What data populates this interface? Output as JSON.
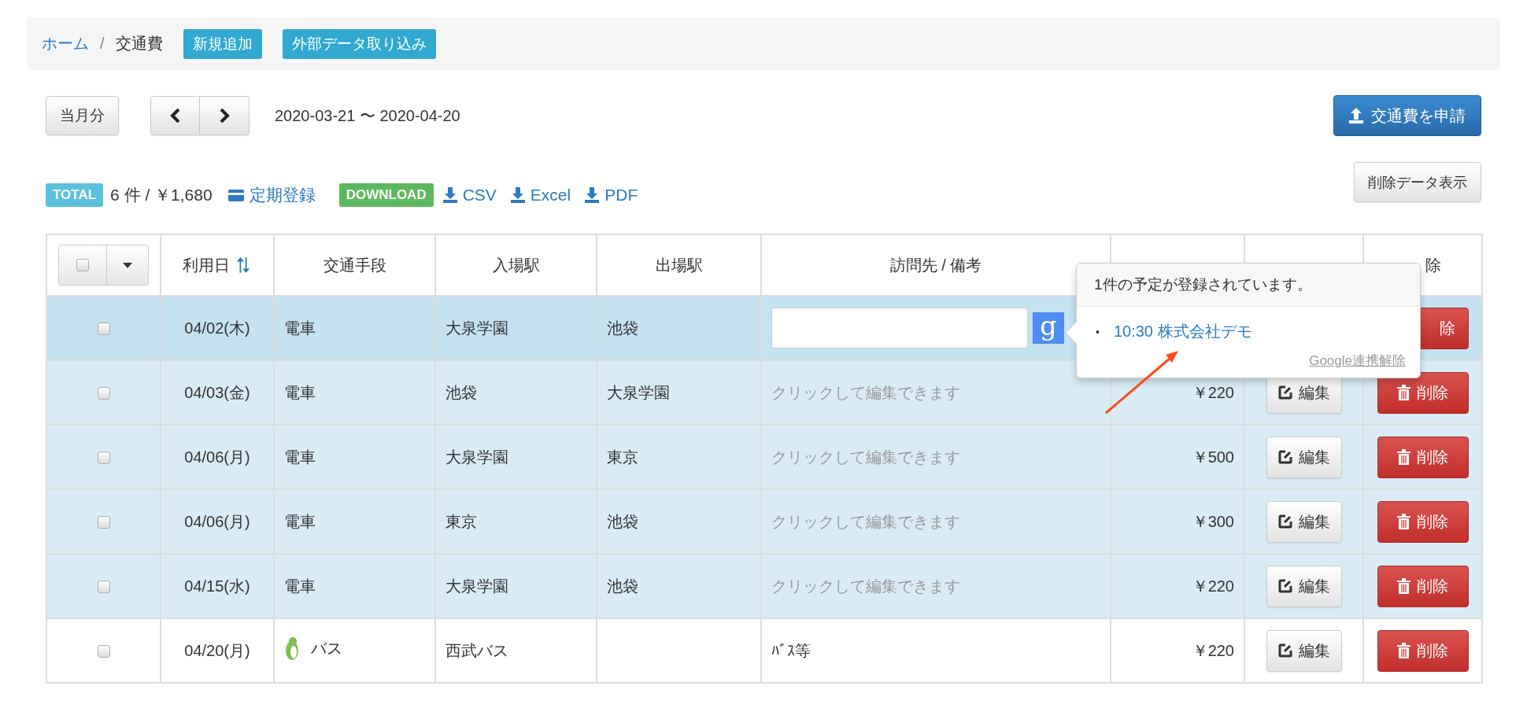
{
  "breadcrumb": {
    "items": [
      {
        "label": "ホーム",
        "kind": "link"
      },
      {
        "label": "交通費",
        "kind": "current"
      }
    ],
    "separator": "/",
    "buttons": [
      "新規追加",
      "外部データ取り込み"
    ]
  },
  "toolbar": {
    "current_month": "当月分",
    "period": "2020-03-21 〜 2020-04-20",
    "apply_button": "交通費を申請"
  },
  "summary": {
    "total_badge": "TOTAL",
    "total": "6 件 / ￥1,680",
    "commuter_link": "定期登録",
    "download_badge": "DOWNLOAD",
    "downloads": [
      "CSV",
      "Excel",
      "PDF"
    ],
    "deleted_button": "削除データ表示"
  },
  "table": {
    "select_all_checked": false,
    "columns": [
      "利用日",
      "交通手段",
      "入場駅",
      "出場駅",
      "訪問先 / 備考"
    ],
    "last_column_partial": "除",
    "rows": [
      {
        "checked": false,
        "selected": true,
        "highlighted": true,
        "date": "04/02(木)",
        "transport": "電車",
        "transport_icon": false,
        "entry": "大泉学園",
        "exit": "池袋",
        "note": {
          "kind": "input",
          "google": "g"
        },
        "delete": "除",
        "delete_partial": true
      },
      {
        "checked": false,
        "selected": false,
        "highlighted": true,
        "date": "04/03(金)",
        "transport": "電車",
        "transport_icon": false,
        "entry": "池袋",
        "exit": "大泉学園",
        "note": {
          "kind": "hint",
          "text": "クリックして編集できます"
        },
        "amount": "￥220",
        "edit": "編集",
        "delete": "削除"
      },
      {
        "checked": false,
        "selected": false,
        "highlighted": true,
        "date": "04/06(月)",
        "transport": "電車",
        "transport_icon": false,
        "entry": "大泉学園",
        "exit": "東京",
        "note": {
          "kind": "hint",
          "text": "クリックして編集できます"
        },
        "amount": "￥500",
        "edit": "編集",
        "delete": "削除"
      },
      {
        "checked": false,
        "selected": false,
        "highlighted": true,
        "date": "04/06(月)",
        "transport": "電車",
        "transport_icon": false,
        "entry": "東京",
        "exit": "池袋",
        "note": {
          "kind": "hint",
          "text": "クリックして編集できます"
        },
        "amount": "￥300",
        "edit": "編集",
        "delete": "削除"
      },
      {
        "checked": false,
        "selected": false,
        "highlighted": true,
        "date": "04/15(水)",
        "transport": "電車",
        "transport_icon": false,
        "entry": "大泉学園",
        "exit": "池袋",
        "note": {
          "kind": "hint",
          "text": "クリックして編集できます"
        },
        "amount": "￥220",
        "edit": "編集",
        "delete": "削除"
      },
      {
        "checked": false,
        "selected": false,
        "highlighted": false,
        "date": "04/20(月)",
        "transport": "バス",
        "transport_icon": true,
        "entry": "西武バス",
        "note": {
          "kind": "text",
          "text": "ﾊﾞｽ等"
        },
        "amount": "￥220",
        "edit": "編集",
        "delete": "削除"
      }
    ]
  },
  "popover": {
    "title": "1件の予定が登録されています。",
    "bullet": "•",
    "events": [
      "10:30 株式会社デモ"
    ],
    "unlink": "Google連携解除"
  }
}
